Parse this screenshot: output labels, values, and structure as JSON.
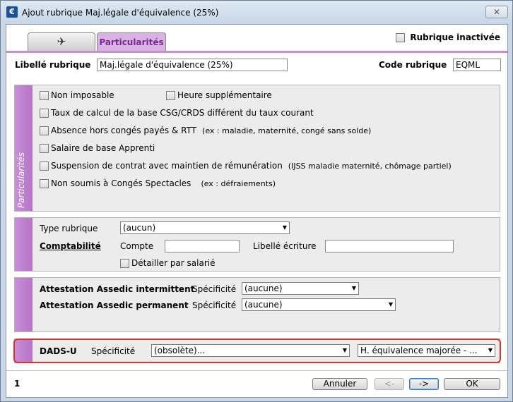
{
  "window": {
    "title": "Ajout rubrique Maj.légale d'équivalence (25%)",
    "close_label": "✕"
  },
  "tabs": {
    "icon_tab_glyph": "✈",
    "active_label": "Particularités"
  },
  "inactive_checkbox": {
    "label": "Rubrique inactivée",
    "checked": false
  },
  "header": {
    "libelle_label": "Libellé rubrique",
    "libelle_value": "Maj.légale d'équivalence (25%)",
    "code_label": "Code rubrique",
    "code_value": "EQML"
  },
  "particularites": {
    "side_label": "Particularités",
    "items": [
      {
        "label": "Non imposable",
        "note": ""
      },
      {
        "label": "Heure supplémentaire",
        "note": ""
      },
      {
        "label": "Taux de calcul de la base CSG/CRDS différent du taux courant",
        "note": ""
      },
      {
        "label": "Absence hors congés payés & RTT",
        "note": "(ex : maladie, maternité, congé sans solde)"
      },
      {
        "label": "Salaire de base Apprenti",
        "note": ""
      },
      {
        "label": "Suspension de contrat avec maintien de rémunération",
        "note": "(IJSS maladie maternité, chômage partiel)"
      },
      {
        "label": "Non soumis à Congés Spectacles",
        "note": "(ex : défraiements)"
      }
    ]
  },
  "compta": {
    "type_label": "Type rubrique",
    "type_value": "(aucun)",
    "comptabilite_label": "Comptabilité",
    "compte_label": "Compte",
    "compte_value": "",
    "libelle_ecriture_label": "Libellé écriture",
    "libelle_ecriture_value": "",
    "detail_label": "Détailler par salarié"
  },
  "assedic": {
    "intermittent_label": "Attestation Assedic intermittent",
    "intermittent_spec_label": "Spécificité",
    "intermittent_value": "(aucune)",
    "permanent_label": "Attestation Assedic permanent",
    "permanent_spec_label": "Spécificité",
    "permanent_value": "(aucune)"
  },
  "dads": {
    "label": "DADS-U",
    "spec_label": "Spécificité",
    "spec_value": "(obsolète)...",
    "second_value": "H. équivalence majorée - ..."
  },
  "footer": {
    "page_number": "1",
    "cancel_label": "Annuler",
    "prev_label": "<-",
    "next_label": "->",
    "ok_label": "OK"
  },
  "colors": {
    "accent_purple": "#c68ed3",
    "highlight_red": "#e0302a"
  }
}
